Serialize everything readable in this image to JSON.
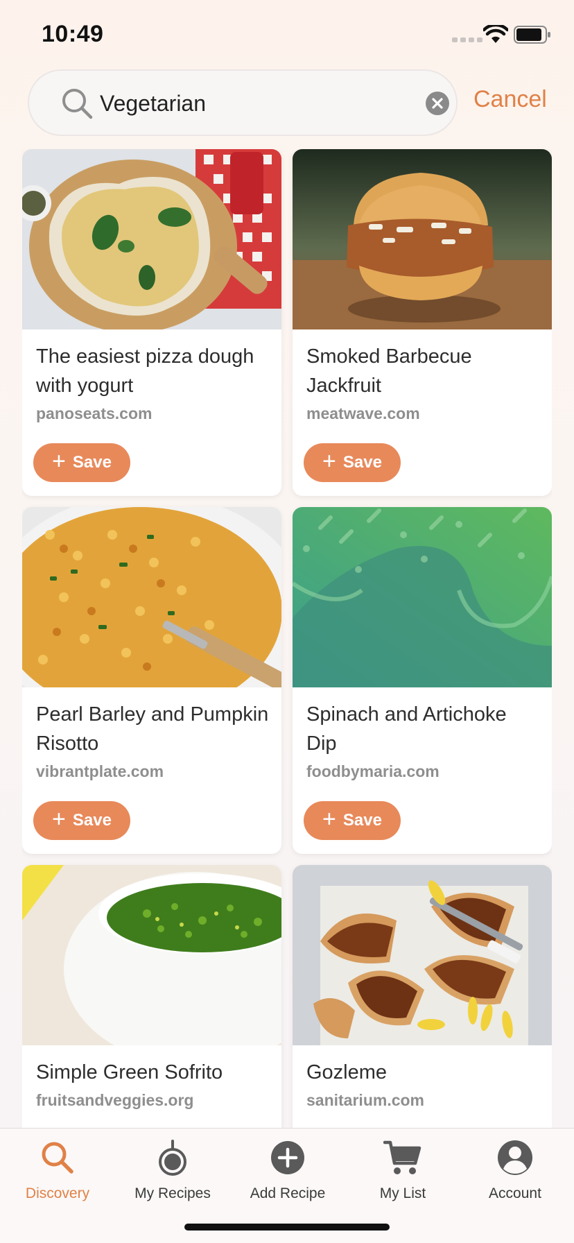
{
  "status_bar": {
    "time": "10:49"
  },
  "search": {
    "value": "Vegetarian",
    "cancel_label": "Cancel"
  },
  "recipes": [
    {
      "title": "The easiest pizza dough with yogurt",
      "source": "panoseats.com",
      "save_label": "Save",
      "image": "pizza-photo"
    },
    {
      "title": "Smoked Barbecue Jackfruit",
      "source": "meatwave.com",
      "save_label": "Save",
      "image": "jackfruit-sandwich-photo"
    },
    {
      "title": "Pearl Barley and Pumpkin Risotto",
      "source": "vibrantplate.com",
      "save_label": "Save",
      "image": "risotto-photo"
    },
    {
      "title": "Spinach and Artichoke Dip",
      "source": "foodbymaria.com",
      "save_label": "Save",
      "image": "placeholder-pattern"
    },
    {
      "title": "Simple Green Sofrito",
      "source": "fruitsandveggies.org",
      "image": "sofrito-photo"
    },
    {
      "title": "Gozleme",
      "source": "sanitarium.com",
      "image": "gozleme-photo"
    }
  ],
  "tabs": [
    {
      "label": "Discovery",
      "icon": "search-icon",
      "active": true
    },
    {
      "label": "My Recipes",
      "icon": "pot-icon"
    },
    {
      "label": "Add Recipe",
      "icon": "add-circle-icon"
    },
    {
      "label": "My List",
      "icon": "cart-icon"
    },
    {
      "label": "Account",
      "icon": "account-icon"
    }
  ],
  "colors": {
    "accent": "#e08147",
    "save_button": "#e8895a"
  }
}
